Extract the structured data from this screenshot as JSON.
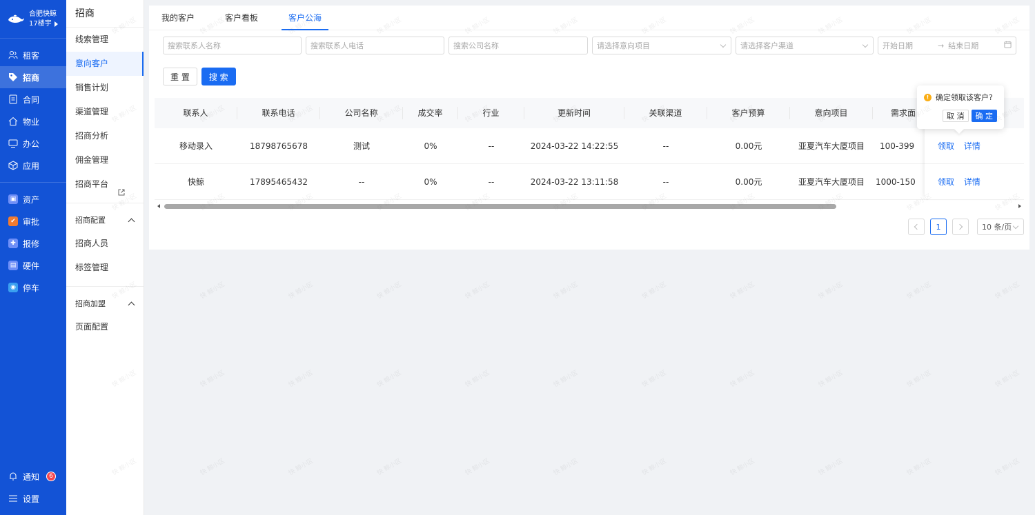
{
  "app": {
    "company": "合肥快鲸",
    "building": "17楼宇"
  },
  "nav": {
    "items": [
      {
        "label": "租客",
        "icon": "users-icon",
        "active": false
      },
      {
        "label": "招商",
        "icon": "tag-icon",
        "active": true
      },
      {
        "label": "合同",
        "icon": "document-icon",
        "active": false
      },
      {
        "label": "物业",
        "icon": "home-icon",
        "active": false
      },
      {
        "label": "办公",
        "icon": "monitor-icon",
        "active": false
      },
      {
        "label": "应用",
        "icon": "cube-icon",
        "active": false
      }
    ],
    "apps": [
      {
        "label": "资产",
        "icon": "asset-icon",
        "color": "#6f8ff7"
      },
      {
        "label": "审批",
        "icon": "approval-icon",
        "color": "#f07b31"
      },
      {
        "label": "报修",
        "icon": "repair-icon",
        "color": "#6f8ff7"
      },
      {
        "label": "硬件",
        "icon": "hardware-icon",
        "color": "#6f8ff7"
      },
      {
        "label": "停车",
        "icon": "parking-icon",
        "color": "#3aa0f0"
      }
    ],
    "notify_label": "通知",
    "notify_count": "6",
    "settings_label": "设置"
  },
  "subnav": {
    "title": "招商",
    "items": [
      "线索管理",
      "意向客户",
      "销售计划",
      "渠道管理",
      "招商分析",
      "佣金管理",
      "招商平台"
    ],
    "group1": "招商配置",
    "group1_items": [
      "招商人员",
      "标签管理"
    ],
    "group2": "招商加盟",
    "group2_items": [
      "页面配置"
    ]
  },
  "tabs": [
    "我的客户",
    "客户看板",
    "客户公海"
  ],
  "filters": {
    "contact_name": "搜索联系人名称",
    "contact_phone": "搜索联系人电话",
    "company_name": "搜索公司名称",
    "project": "请选择意向项目",
    "channel": "请选择客户渠道",
    "start_date": "开始日期",
    "date_sep": "→",
    "end_date": "结束日期"
  },
  "buttons": {
    "reset": "重 置",
    "search": "搜 索"
  },
  "table": {
    "headers": [
      "联系人",
      "联系电话",
      "公司名称",
      "成交率",
      "行业",
      "更新时间",
      "关联渠道",
      "客户预算",
      "意向项目",
      "需求面"
    ],
    "rows": [
      {
        "contact": "移动录入",
        "phone": "18798765678",
        "company": "测试",
        "rate": "0%",
        "industry": "--",
        "updated": "2024-03-22 14:22:55",
        "channel": "--",
        "budget": "0.00元",
        "project": "亚夏汽车大厦项目",
        "area": "100-399"
      },
      {
        "contact": "快鲸",
        "phone": "17895465432",
        "company": "--",
        "rate": "0%",
        "industry": "--",
        "updated": "2024-03-22 13:11:58",
        "channel": "--",
        "budget": "0.00元",
        "project": "亚夏汽车大厦项目",
        "area": "1000-150"
      }
    ],
    "claim_label": "领取",
    "detail_label": "详情"
  },
  "pagination": {
    "current": "1",
    "page_size": "10 条/页"
  },
  "popconfirm": {
    "message": "确定领取该客户?",
    "cancel": "取 消",
    "ok": "确 定"
  },
  "watermark": "快 鲸小区",
  "colors": {
    "primary": "#1a6cf2",
    "sidebar": "#1353d6",
    "warning": "#faad14",
    "badge": "#f5454e"
  }
}
